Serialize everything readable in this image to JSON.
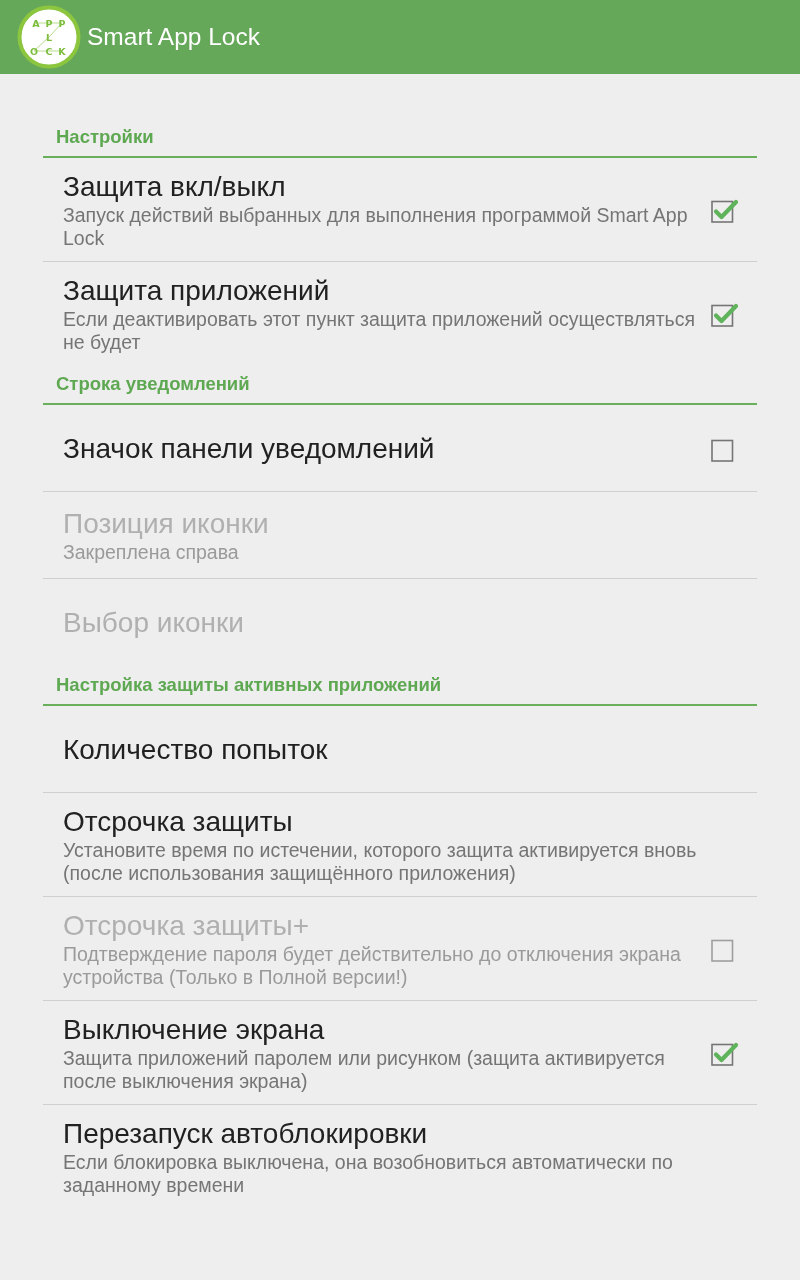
{
  "app_bar": {
    "logo_letters": [
      "A",
      "P",
      "P",
      "L",
      "O",
      "C",
      "K"
    ],
    "title": "Smart App Lock"
  },
  "sections": [
    {
      "title": "Настройки",
      "items": [
        {
          "kind": "checkbox",
          "title": "Защита вкл/выкл",
          "summary": "Запуск действий выбранных для выполнения программой Smart App Lock",
          "disabled": false,
          "checked": true
        },
        {
          "kind": "checkbox",
          "title": "Защита приложений",
          "summary": "Если деактивировать этот пункт защита приложений осуществляться не будет",
          "disabled": false,
          "checked": true
        }
      ]
    },
    {
      "title": "Строка уведомлений",
      "items": [
        {
          "kind": "checkbox",
          "title": "Значок панели уведомлений",
          "disabled": false,
          "checked": false
        },
        {
          "kind": "plain",
          "title": "Позиция иконки",
          "summary": "Закреплена справа",
          "disabled": true
        },
        {
          "kind": "plain",
          "title": "Выбор иконки",
          "disabled": true
        }
      ]
    },
    {
      "title": "Настройка защиты активных приложений",
      "items": [
        {
          "kind": "plain",
          "title": "Количество попыток",
          "disabled": false
        },
        {
          "kind": "plain",
          "title": "Отсрочка защиты",
          "summary": "Установите время по истечении, которого защита активируется вновь (после использования защищённого приложения)",
          "disabled": false
        },
        {
          "kind": "checkbox",
          "title": "Отсрочка защиты+",
          "summary": "Подтверждение пароля будет действительно до отключения экрана устройства (Только в Полной версии!)",
          "disabled": true,
          "checked": false
        },
        {
          "kind": "checkbox",
          "title": "Выключение экрана",
          "summary": "Защита приложений паролем или рисунком (защита активируется после выключения экрана)",
          "disabled": false,
          "checked": true
        },
        {
          "kind": "plain",
          "title": "Перезапуск автоблокировки",
          "summary": "Если блокировка выключена, она возобновиться автоматически по заданному времени",
          "disabled": false
        }
      ]
    }
  ]
}
